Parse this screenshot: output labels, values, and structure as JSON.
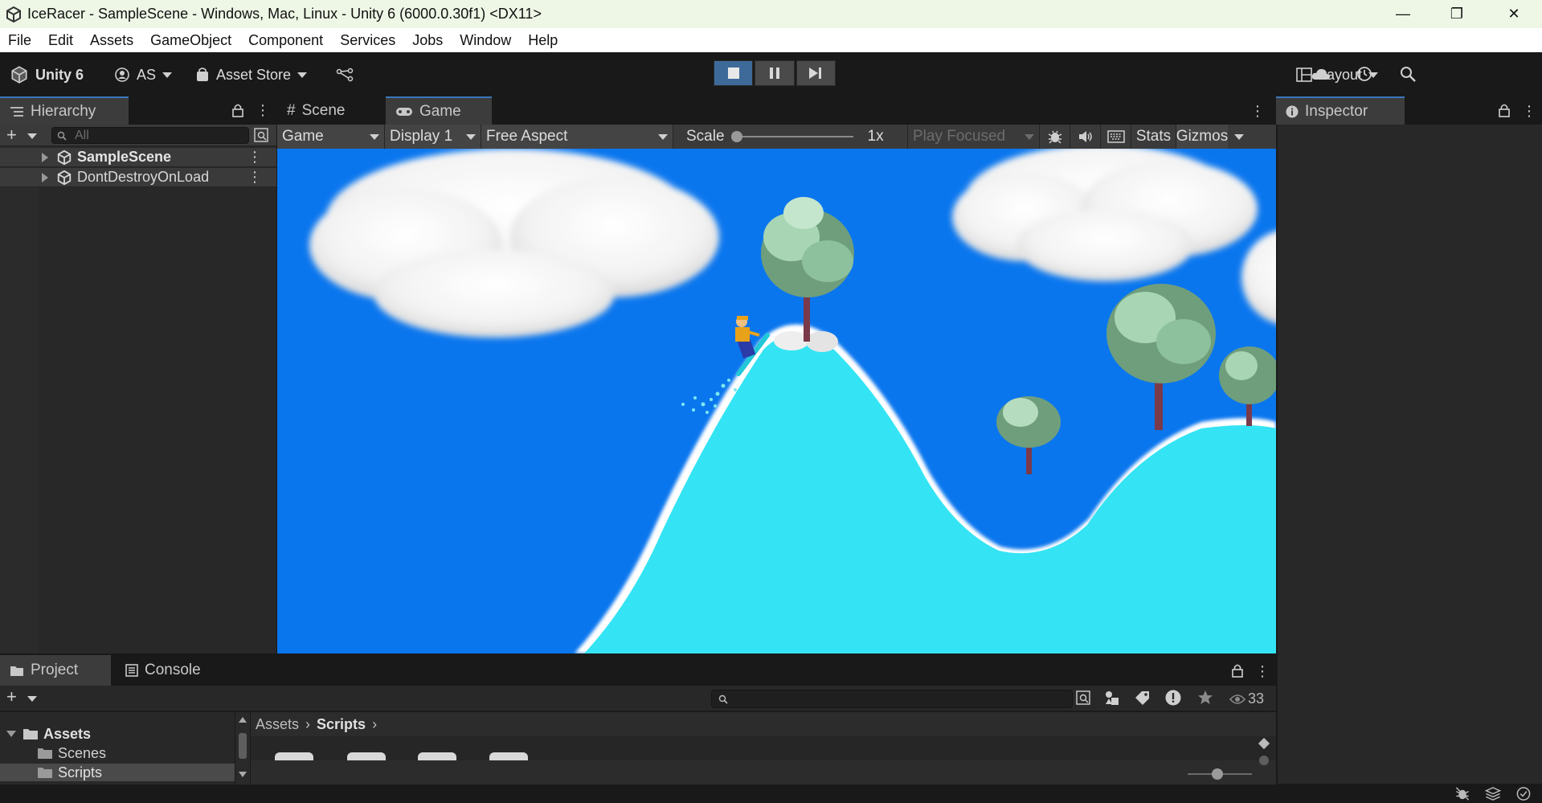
{
  "window": {
    "title": "IceRacer - SampleScene - Windows, Mac, Linux - Unity 6 (6000.0.30f1) <DX11>",
    "minimize": "—",
    "maximize": "❐",
    "close": "✕"
  },
  "menu": [
    "File",
    "Edit",
    "Assets",
    "GameObject",
    "Component",
    "Services",
    "Jobs",
    "Window",
    "Help"
  ],
  "toolbar": {
    "unity_label": "Unity 6",
    "account_label": "AS",
    "asset_store_label": "Asset Store",
    "layout_label": "Layout",
    "play_state": "playing"
  },
  "hierarchy": {
    "tab_label": "Hierarchy",
    "search_placeholder": "All",
    "items": [
      {
        "label": "SampleScene"
      },
      {
        "label": "DontDestroyOnLoad"
      }
    ]
  },
  "game_view": {
    "tabs": [
      {
        "label": "Scene"
      },
      {
        "label": "Game"
      }
    ],
    "mode_dropdown": "Game",
    "display_dropdown": "Display 1",
    "aspect_dropdown": "Free Aspect",
    "scale_label": "Scale",
    "scale_value": "1x",
    "play_focused_label": "Play Focused",
    "stats_label": "Stats",
    "gizmos_label": "Gizmos"
  },
  "inspector": {
    "tab_label": "Inspector"
  },
  "project": {
    "tabs": [
      {
        "label": "Project"
      },
      {
        "label": "Console"
      }
    ],
    "hidden_count": "33",
    "breadcrumb": [
      "Assets",
      "Scripts"
    ],
    "tree": [
      {
        "label": "Assets"
      },
      {
        "label": "Scenes"
      },
      {
        "label": "Scripts"
      }
    ]
  },
  "colors": {
    "sky": "#0a76ee",
    "snow": "#34e4f4",
    "accent": "#3a79bb"
  }
}
